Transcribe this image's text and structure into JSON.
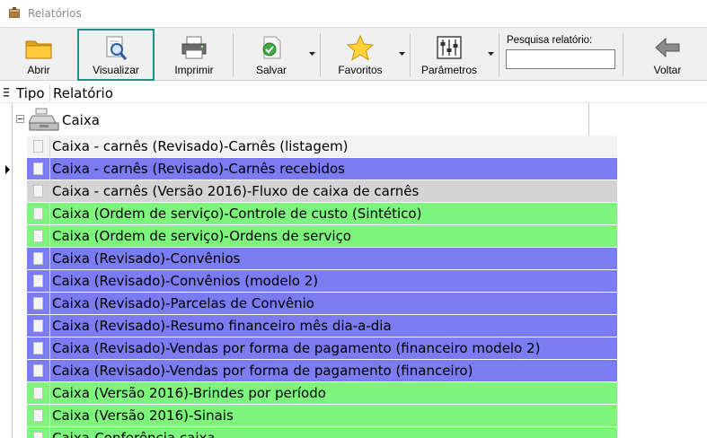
{
  "window": {
    "title": "Relatórios"
  },
  "toolbar": {
    "open_label": "Abrir",
    "view_label": "Visualizar",
    "print_label": "Imprimir",
    "save_label": "Salvar",
    "favorites_label": "Favoritos",
    "params_label": "Parâmetros",
    "back_label": "Voltar",
    "search_label": "Pesquisa relatório:",
    "search_value": ""
  },
  "grid": {
    "col_type": "Tipo",
    "col_report": "Relatório",
    "group": {
      "name": "Caixa",
      "expanded": true
    },
    "rows": [
      {
        "text": "Caixa - carnês (Revisado)-Carnês (listagem)",
        "color": "#f3f3f3",
        "current": true
      },
      {
        "text": "Caixa - carnês (Revisado)-Carnês recebidos",
        "color": "#7b7bf2"
      },
      {
        "text": "Caixa - carnês (Versão 2016)-Fluxo de caixa de carnês",
        "color": "#d4d4d4"
      },
      {
        "text": "Caixa (Ordem de serviço)-Controle de custo (Sintético)",
        "color": "#7df57d"
      },
      {
        "text": "Caixa (Ordem de serviço)-Ordens de serviço",
        "color": "#7df57d"
      },
      {
        "text": "Caixa (Revisado)-Convênios",
        "color": "#7b7bf2"
      },
      {
        "text": "Caixa (Revisado)-Convênios (modelo 2)",
        "color": "#7b7bf2"
      },
      {
        "text": "Caixa (Revisado)-Parcelas de Convênio",
        "color": "#7b7bf2"
      },
      {
        "text": "Caixa (Revisado)-Resumo financeiro mês dia-a-dia",
        "color": "#7b7bf2"
      },
      {
        "text": "Caixa (Revisado)-Vendas por forma de pagamento (financeiro modelo 2)",
        "color": "#7b7bf2"
      },
      {
        "text": "Caixa (Revisado)-Vendas por forma de pagamento (financeiro)",
        "color": "#7b7bf2"
      },
      {
        "text": "Caixa (Versão 2016)-Brindes por período",
        "color": "#7df57d"
      },
      {
        "text": "Caixa (Versão 2016)-Sinais",
        "color": "#7df57d"
      },
      {
        "text": "Caixa-Conferência caixa",
        "color": "#7df57d"
      }
    ]
  }
}
